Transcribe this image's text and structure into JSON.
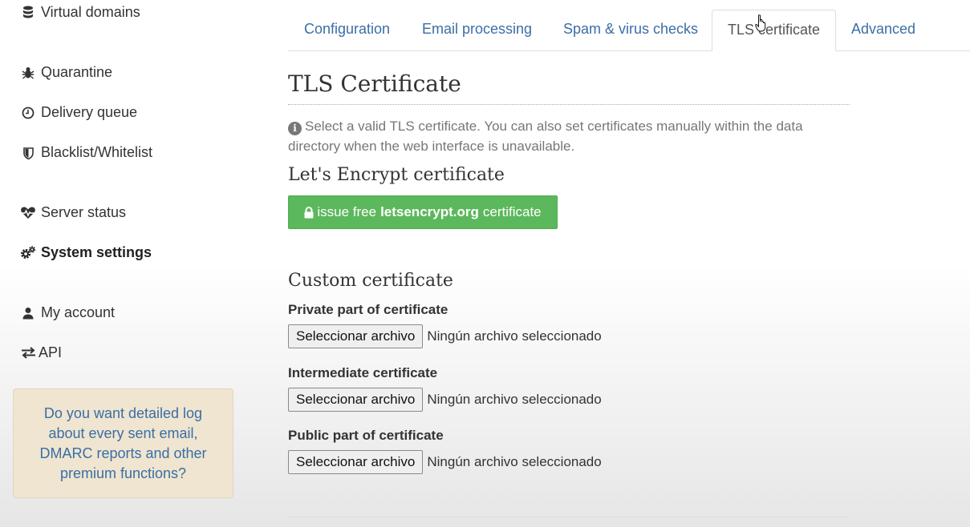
{
  "sidebar": {
    "items": [
      {
        "label": "Virtual domains",
        "icon": "database-icon"
      },
      {
        "label": "Quarantine",
        "icon": "bug-icon"
      },
      {
        "label": "Delivery queue",
        "icon": "clock-icon"
      },
      {
        "label": "Blacklist/Whitelist",
        "icon": "shield-icon"
      },
      {
        "label": "Server status",
        "icon": "heartbeat-icon"
      },
      {
        "label": "System settings",
        "icon": "gears-icon",
        "active": true
      },
      {
        "label": "My account",
        "icon": "user-icon"
      },
      {
        "label": "API",
        "icon": "exchange-icon"
      }
    ],
    "promo": "Do you want detailed log about every sent email, DMARC reports and other premium functions?"
  },
  "tabs": [
    {
      "label": "Configuration"
    },
    {
      "label": "Email processing"
    },
    {
      "label": "Spam & virus checks"
    },
    {
      "label": "TLS certificate",
      "active": true
    },
    {
      "label": "Advanced"
    }
  ],
  "main": {
    "title": "TLS Certificate",
    "info": "Select a valid TLS certificate. You can also set certificates manually within the data directory when the web interface is unavailable.",
    "letsencrypt_heading": "Let's Encrypt certificate",
    "letsencrypt_button": {
      "prefix": "issue free",
      "bold": "letsencrypt.org",
      "suffix": "certificate"
    },
    "custom_heading": "Custom certificate",
    "fields": [
      {
        "label": "Private part of certificate",
        "button": "Seleccionar archivo",
        "status": "Ningún archivo seleccionado"
      },
      {
        "label": "Intermediate certificate",
        "button": "Seleccionar archivo",
        "status": "Ningún archivo seleccionado"
      },
      {
        "label": "Public part of certificate",
        "button": "Seleccionar archivo",
        "status": "Ningún archivo seleccionado"
      }
    ]
  },
  "colors": {
    "link": "#3a6ea5",
    "success": "#5cb85c",
    "promo_bg": "#efe5d0"
  }
}
